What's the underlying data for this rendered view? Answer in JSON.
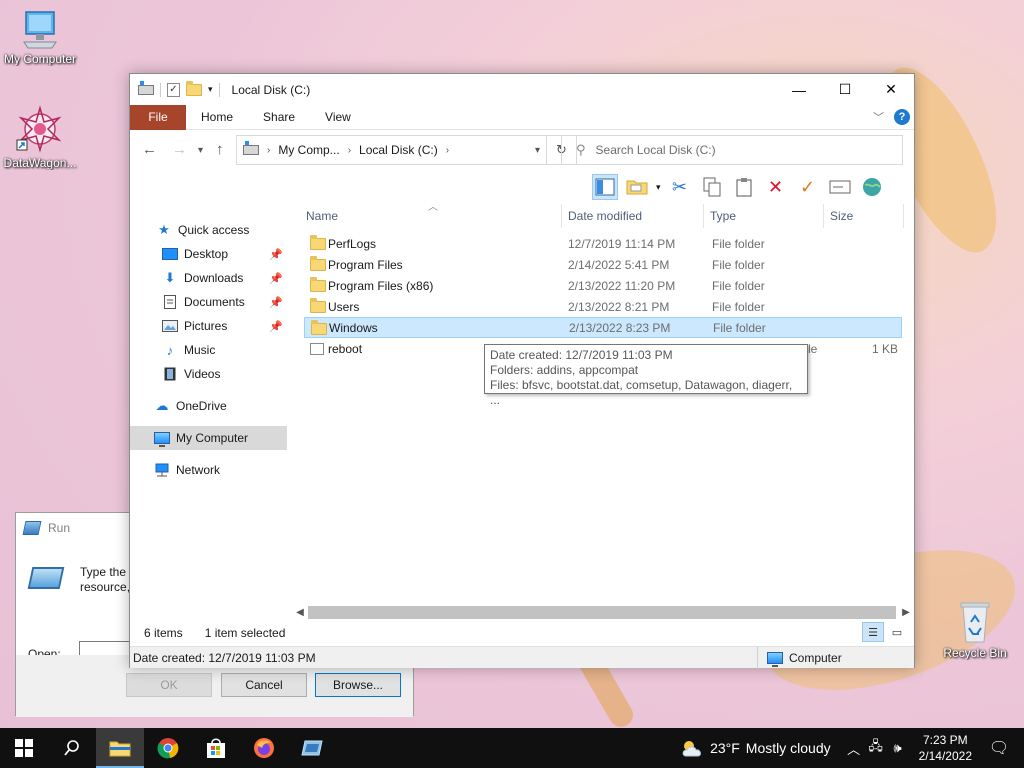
{
  "desktop": {
    "icons": [
      {
        "label": "My Computer"
      },
      {
        "label": "DataWagon..."
      },
      {
        "label": "Recycle Bin"
      }
    ]
  },
  "run_dialog": {
    "title": "Run",
    "desc_line1": "Type the n",
    "desc_line2": "resource, ",
    "open_label": "Open:",
    "open_value": "",
    "ok_label": "OK",
    "cancel_label": "Cancel",
    "browse_label": "Browse..."
  },
  "explorer": {
    "title": "Local Disk (C:)",
    "ribbon_tabs": [
      "File",
      "Home",
      "Share",
      "View"
    ],
    "address": {
      "segments": [
        "My Comp...",
        "Local Disk (C:)"
      ]
    },
    "search_placeholder": "Search Local Disk (C:)",
    "nav": [
      {
        "label": "Quick access",
        "icon": "star-icon"
      },
      {
        "label": "Desktop",
        "icon": "desktop-icon",
        "pinned": true
      },
      {
        "label": "Downloads",
        "icon": "download-icon",
        "pinned": true
      },
      {
        "label": "Documents",
        "icon": "documents-icon",
        "pinned": true
      },
      {
        "label": "Pictures",
        "icon": "pictures-icon",
        "pinned": true
      },
      {
        "label": "Music",
        "icon": "music-icon"
      },
      {
        "label": "Videos",
        "icon": "videos-icon"
      },
      {
        "label": "OneDrive",
        "icon": "cloud-icon"
      },
      {
        "label": "My Computer",
        "icon": "computer-icon",
        "selected": true
      },
      {
        "label": "Network",
        "icon": "network-icon"
      }
    ],
    "columns": [
      "Name",
      "Date modified",
      "Type",
      "Size"
    ],
    "files": [
      {
        "name": "PerfLogs",
        "date": "12/7/2019 11:14 PM",
        "type": "File folder",
        "size": "",
        "kind": "folder"
      },
      {
        "name": "Program Files",
        "date": "2/14/2022 5:41 PM",
        "type": "File folder",
        "size": "",
        "kind": "folder"
      },
      {
        "name": "Program Files (x86)",
        "date": "2/13/2022 11:20 PM",
        "type": "File folder",
        "size": "",
        "kind": "folder"
      },
      {
        "name": "Users",
        "date": "2/13/2022 8:21 PM",
        "type": "File folder",
        "size": "",
        "kind": "folder"
      },
      {
        "name": "Windows",
        "date": "2/13/2022 8:23 PM",
        "type": "File folder",
        "size": "",
        "kind": "folder",
        "selected": true
      },
      {
        "name": "reboot",
        "date": "",
        "type": "le",
        "size": "1 KB",
        "kind": "file"
      }
    ],
    "tooltip": {
      "line1": "Date created: 12/7/2019 11:03 PM",
      "line2": "Folders: addins, appcompat",
      "line3": "Files: bfsvc, bootstat.dat, comsetup, Datawagon, diagerr, ..."
    },
    "status": {
      "items": "6 items",
      "selected": "1 item selected"
    },
    "details": {
      "left": "Date created: 12/7/2019 11:03 PM",
      "right": "Computer"
    }
  },
  "taskbar": {
    "weather_temp": "23°F",
    "weather_text": "Mostly cloudy",
    "time": "7:23 PM",
    "date": "2/14/2022"
  },
  "colors": {
    "file_tab": "#a7452c",
    "selection": "#cce8ff",
    "taskbar": "#101010",
    "delete_red": "#e81123",
    "check_orange": "#e07a1f"
  }
}
